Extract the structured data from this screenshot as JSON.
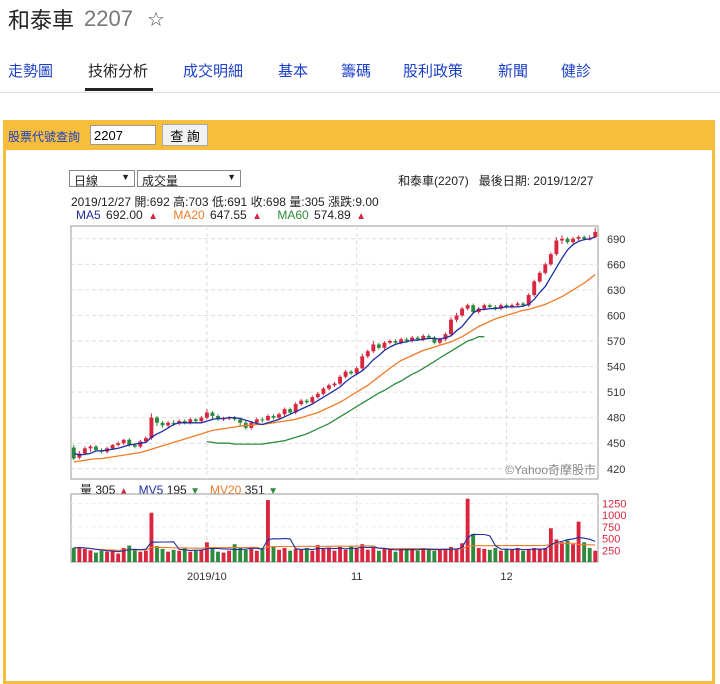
{
  "header": {
    "stock_name": "和泰車",
    "stock_code": "2207",
    "star_icon": "star-outline-icon"
  },
  "nav": {
    "tabs": [
      "走勢圖",
      "技術分析",
      "成交明細",
      "基本",
      "籌碼",
      "股利政策",
      "新聞",
      "健診"
    ],
    "active": "技術分析"
  },
  "query": {
    "label": "股票代號查詢",
    "value": "2207",
    "button": "查 詢"
  },
  "controls": {
    "period": "日線",
    "indicator": "成交量"
  },
  "info": {
    "stock": "和泰車(2207)",
    "last_date_label": "最後日期:",
    "last_date": "2019/12/27",
    "date": "2019/12/27",
    "open_label": "開:",
    "open": "692",
    "high_label": "高:",
    "high": "703",
    "low_label": "低:",
    "low": "691",
    "close_label": "收:",
    "close": "698",
    "vol_label": "量:",
    "vol": "305",
    "change_label": "漲跌:",
    "change": "9.00"
  },
  "ma": {
    "ma5_label": "MA5",
    "ma5": "692.00",
    "ma20_label": "MA20",
    "ma20": "647.55",
    "ma60_label": "MA60",
    "ma60": "574.89"
  },
  "volume": {
    "vol_label": "量",
    "vol": "305",
    "mv5_label": "MV5",
    "mv5": "195",
    "mv20_label": "MV20",
    "mv20": "351"
  },
  "watermark": "©Yahoo奇摩股市",
  "colors": {
    "up": "#d9263f",
    "down": "#2e8b3e",
    "ma5": "#1e2fa0",
    "ma20": "#f07c28",
    "ma60": "#2e8b3e",
    "accent": "#f6be3a",
    "link": "#1a3fc9"
  },
  "chart_data": {
    "type": "candlestick",
    "price_axis": {
      "ylim": [
        408,
        705
      ],
      "ticks": [
        420,
        450,
        480,
        510,
        540,
        570,
        600,
        630,
        660,
        690
      ]
    },
    "volume_axis": {
      "ylim": [
        0,
        1450
      ],
      "ticks": [
        250,
        500,
        750,
        1000,
        1250
      ]
    },
    "x_tick_labels": [
      {
        "label": "2019/10",
        "index": 24
      },
      {
        "label": "11",
        "index": 51
      },
      {
        "label": "12",
        "index": 78
      }
    ],
    "ohlc": [
      [
        445,
        432,
        448,
        430
      ],
      [
        433,
        438,
        441,
        431
      ],
      [
        438,
        444,
        446,
        436
      ],
      [
        444,
        446,
        448,
        440
      ],
      [
        446,
        442,
        448,
        440
      ],
      [
        442,
        440,
        444,
        438
      ],
      [
        440,
        444,
        446,
        438
      ],
      [
        444,
        448,
        449,
        442
      ],
      [
        448,
        450,
        452,
        446
      ],
      [
        450,
        454,
        455,
        448
      ],
      [
        454,
        448,
        456,
        446
      ],
      [
        448,
        446,
        450,
        444
      ],
      [
        446,
        452,
        454,
        444
      ],
      [
        452,
        456,
        458,
        450
      ],
      [
        456,
        480,
        485,
        454
      ],
      [
        480,
        474,
        482,
        470
      ],
      [
        474,
        471,
        476,
        468
      ],
      [
        471,
        474,
        476,
        469
      ],
      [
        474,
        473,
        477,
        470
      ],
      [
        473,
        476,
        478,
        471
      ],
      [
        476,
        474,
        478,
        472
      ],
      [
        474,
        478,
        480,
        472
      ],
      [
        478,
        476,
        480,
        474
      ],
      [
        476,
        480,
        482,
        474
      ],
      [
        480,
        486,
        490,
        478
      ],
      [
        486,
        482,
        488,
        478
      ],
      [
        482,
        478,
        484,
        476
      ],
      [
        478,
        479,
        481,
        476
      ],
      [
        479,
        480,
        482,
        477
      ],
      [
        480,
        478,
        482,
        476
      ],
      [
        478,
        474,
        480,
        470
      ],
      [
        474,
        468,
        476,
        466
      ],
      [
        468,
        474,
        476,
        466
      ],
      [
        474,
        478,
        480,
        472
      ],
      [
        478,
        477,
        480,
        474
      ],
      [
        477,
        482,
        484,
        476
      ],
      [
        482,
        480,
        484,
        478
      ],
      [
        480,
        484,
        486,
        478
      ],
      [
        484,
        490,
        492,
        482
      ],
      [
        490,
        486,
        492,
        484
      ],
      [
        486,
        496,
        498,
        484
      ],
      [
        496,
        500,
        502,
        494
      ],
      [
        500,
        498,
        502,
        496
      ],
      [
        498,
        504,
        506,
        496
      ],
      [
        504,
        508,
        510,
        502
      ],
      [
        508,
        514,
        516,
        506
      ],
      [
        514,
        518,
        520,
        512
      ],
      [
        518,
        520,
        522,
        516
      ],
      [
        520,
        528,
        530,
        518
      ],
      [
        528,
        534,
        536,
        526
      ],
      [
        534,
        532,
        536,
        530
      ],
      [
        532,
        538,
        540,
        530
      ],
      [
        538,
        552,
        555,
        536
      ],
      [
        552,
        558,
        560,
        550
      ],
      [
        558,
        566,
        570,
        556
      ],
      [
        566,
        562,
        568,
        560
      ],
      [
        562,
        568,
        570,
        560
      ],
      [
        568,
        570,
        572,
        566
      ],
      [
        570,
        568,
        572,
        566
      ],
      [
        568,
        572,
        574,
        566
      ],
      [
        572,
        570,
        574,
        568
      ],
      [
        570,
        574,
        576,
        568
      ],
      [
        574,
        572,
        576,
        570
      ],
      [
        572,
        576,
        578,
        570
      ],
      [
        576,
        574,
        578,
        572
      ],
      [
        574,
        568,
        576,
        566
      ],
      [
        568,
        572,
        574,
        566
      ],
      [
        572,
        578,
        580,
        570
      ],
      [
        578,
        595,
        598,
        576
      ],
      [
        595,
        600,
        603,
        592
      ],
      [
        600,
        608,
        610,
        598
      ],
      [
        608,
        612,
        614,
        606
      ],
      [
        612,
        604,
        614,
        602
      ],
      [
        604,
        608,
        610,
        602
      ],
      [
        608,
        612,
        614,
        606
      ],
      [
        612,
        610,
        614,
        608
      ],
      [
        610,
        608,
        612,
        606
      ],
      [
        608,
        612,
        614,
        606
      ],
      [
        612,
        610,
        614,
        608
      ],
      [
        610,
        612,
        614,
        608
      ],
      [
        612,
        614,
        616,
        610
      ],
      [
        614,
        612,
        616,
        610
      ],
      [
        612,
        624,
        626,
        610
      ],
      [
        624,
        640,
        642,
        622
      ],
      [
        640,
        650,
        652,
        638
      ],
      [
        650,
        660,
        662,
        648
      ],
      [
        660,
        672,
        674,
        658
      ],
      [
        672,
        688,
        692,
        670
      ],
      [
        688,
        690,
        694,
        684
      ],
      [
        690,
        686,
        692,
        684
      ],
      [
        686,
        690,
        692,
        684
      ],
      [
        690,
        692,
        694,
        688
      ],
      [
        692,
        690,
        694,
        688
      ],
      [
        690,
        690,
        694,
        688
      ],
      [
        692,
        698,
        703,
        691
      ]
    ],
    "ma5": [
      438,
      436,
      437,
      438,
      441,
      441,
      442,
      443,
      444,
      446,
      448,
      449,
      450,
      451,
      457,
      461,
      464,
      468,
      472,
      474,
      474,
      474,
      474,
      474,
      476,
      478,
      479,
      479,
      480,
      480,
      479,
      477,
      475,
      473,
      472,
      474,
      476,
      478,
      481,
      484,
      487,
      490,
      493,
      496,
      500,
      504,
      508,
      512,
      516,
      522,
      527,
      531,
      535,
      541,
      548,
      553,
      559,
      563,
      566,
      568,
      569,
      571,
      571,
      572,
      573,
      573,
      572,
      574,
      576,
      582,
      587,
      595,
      603,
      607,
      607,
      608,
      608,
      609,
      610,
      610,
      610,
      611,
      613,
      619,
      627,
      634,
      645,
      656,
      667,
      677,
      683,
      687,
      689,
      690,
      692
    ],
    "ma20": [
      428,
      429,
      430,
      431,
      432,
      432,
      433,
      434,
      435,
      436,
      437,
      438,
      439,
      441,
      443,
      445,
      447,
      449,
      451,
      453,
      455,
      457,
      459,
      461,
      463,
      465,
      466,
      467,
      468,
      469,
      470,
      471,
      471,
      472,
      472,
      473,
      474,
      475,
      476,
      477,
      478,
      480,
      482,
      484,
      486,
      489,
      492,
      495,
      498,
      502,
      506,
      510,
      514,
      518,
      523,
      528,
      533,
      538,
      543,
      547,
      550,
      553,
      556,
      559,
      561,
      563,
      565,
      567,
      569,
      572,
      575,
      579,
      583,
      587,
      590,
      593,
      596,
      598,
      600,
      602,
      604,
      606,
      607,
      609,
      611,
      613,
      616,
      619,
      622,
      626,
      630,
      634,
      638,
      643,
      648
    ],
    "ma60_start_index": 24,
    "ma60": [
      452,
      451,
      450,
      450,
      450,
      449,
      449,
      449,
      449,
      449,
      449,
      450,
      451,
      452,
      453,
      455,
      457,
      459,
      461,
      464,
      467,
      470,
      473,
      477,
      481,
      485,
      489,
      493,
      497,
      501,
      505,
      509,
      512,
      516,
      520,
      523,
      527,
      531,
      534,
      538,
      542,
      546,
      550,
      554,
      558,
      562,
      566,
      570,
      572,
      575,
      575
    ],
    "volume": [
      300,
      320,
      280,
      250,
      200,
      240,
      220,
      260,
      180,
      300,
      350,
      260,
      220,
      240,
      1050,
      340,
      280,
      220,
      260,
      240,
      300,
      220,
      240,
      260,
      420,
      300,
      220,
      200,
      240,
      380,
      300,
      260,
      280,
      240,
      300,
      1320,
      340,
      260,
      300,
      240,
      280,
      260,
      300,
      240,
      360,
      280,
      300,
      240,
      320,
      260,
      340,
      300,
      380,
      260,
      300,
      240,
      280,
      260,
      220,
      300,
      260,
      280,
      240,
      300,
      260,
      240,
      280,
      260,
      320,
      280,
      400,
      1350,
      600,
      300,
      280,
      260,
      300,
      240,
      280,
      260,
      300,
      240,
      260,
      300,
      280,
      300,
      720,
      480,
      420,
      460,
      380,
      860,
      420,
      300,
      240
    ],
    "volume_dir": [
      0,
      1,
      1,
      1,
      0,
      0,
      1,
      1,
      1,
      1,
      0,
      0,
      1,
      1,
      1,
      0,
      0,
      1,
      0,
      1,
      0,
      1,
      0,
      1,
      1,
      0,
      0,
      1,
      1,
      0,
      0,
      0,
      1,
      1,
      0,
      1,
      0,
      1,
      1,
      0,
      1,
      1,
      0,
      1,
      1,
      1,
      1,
      1,
      1,
      1,
      0,
      1,
      1,
      1,
      1,
      0,
      1,
      1,
      0,
      1,
      0,
      1,
      0,
      1,
      0,
      0,
      1,
      1,
      1,
      1,
      1,
      1,
      0,
      1,
      1,
      0,
      0,
      1,
      0,
      1,
      1,
      0,
      1,
      1,
      1,
      1,
      1,
      1,
      1,
      0,
      1,
      1,
      0,
      0,
      1
    ]
  }
}
